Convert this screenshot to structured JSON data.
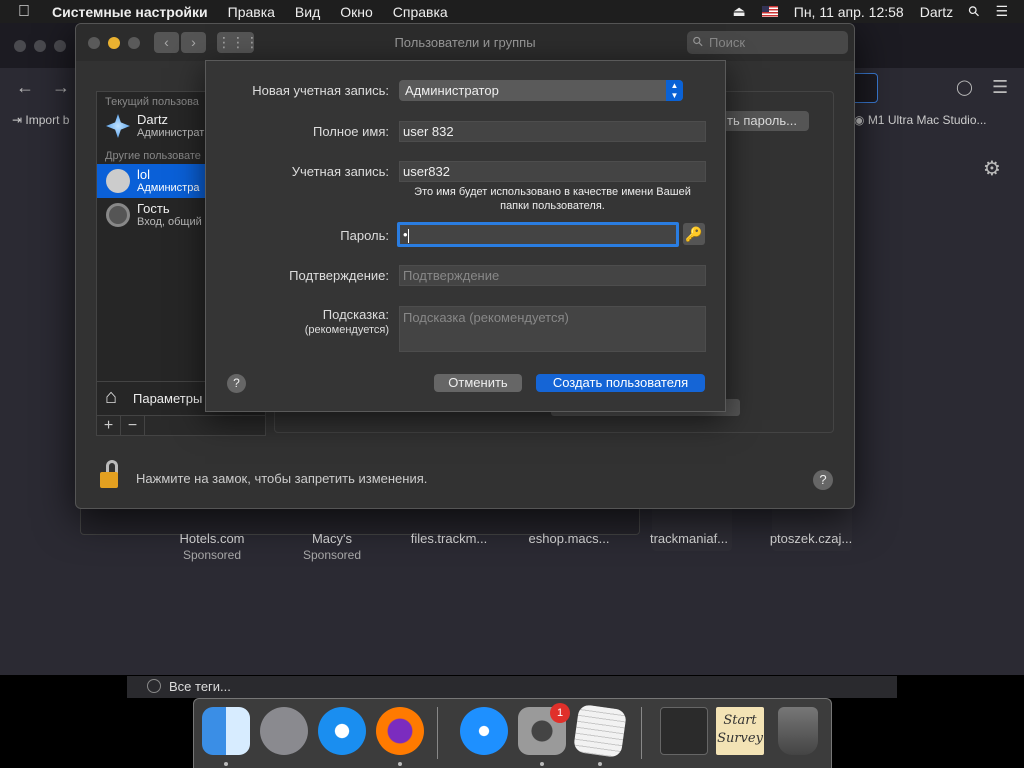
{
  "menubar": {
    "app": "Системные настройки",
    "items": [
      "Правка",
      "Вид",
      "Окно",
      "Справка"
    ],
    "datetime": "Пн, 11 апр. 12:58",
    "user": "Dartz"
  },
  "browser": {
    "bookmarks": [
      "Import b",
      "M1 Ultra Mac Studio..."
    ],
    "tiles": [
      {
        "title": "Hotels.com",
        "sub": "Sponsored"
      },
      {
        "title": "Macy's",
        "sub": "Sponsored"
      },
      {
        "title": "files.trackm...",
        "sub": ""
      },
      {
        "title": "eshop.macs...",
        "sub": ""
      },
      {
        "title": "trackmaniaf...",
        "sub": ""
      },
      {
        "title": "ptoszek.czaj...",
        "sub": ""
      }
    ],
    "tags_label": "Все теги..."
  },
  "window": {
    "title": "Пользователи и группы",
    "search_placeholder": "Поиск",
    "current_header": "Текущий пользова",
    "other_header": "Другие пользовате",
    "users": [
      {
        "name": "Dartz",
        "role": "Администрат"
      },
      {
        "name": "lol",
        "role": "Администра"
      },
      {
        "name": "Гость",
        "role": "Вход, общий"
      }
    ],
    "params_label": "Параметры",
    "password_btn": "ть пароль...",
    "lock_text": "Нажмите на замок, чтобы запретить изменения."
  },
  "sheet": {
    "account_type_label": "Новая учетная запись:",
    "account_type_value": "Администратор",
    "fullname_label": "Полное имя:",
    "fullname_value": "user 832",
    "account_label": "Учетная запись:",
    "account_value": "user832",
    "account_hint": "Это имя будет использовано в качестве имени Вашей папки пользователя.",
    "password_label": "Пароль:",
    "password_value": "•",
    "verify_label": "Подтверждение:",
    "verify_placeholder": "Подтверждение",
    "hint_label": "Подсказка:",
    "hint_label_sub": "(рекомендуется)",
    "hint_placeholder": "Подсказка (рекомендуется)",
    "cancel": "Отменить",
    "create": "Создать пользователя",
    "help": "?"
  },
  "dock": {
    "notes_label": "Start Survey",
    "settings_badge": "1"
  }
}
